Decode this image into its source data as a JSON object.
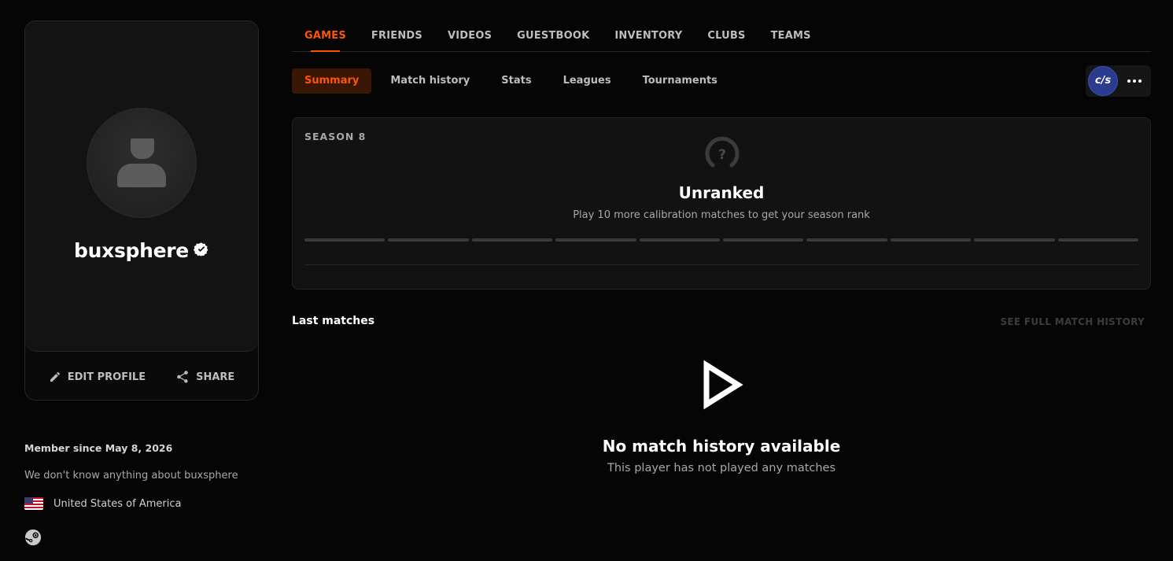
{
  "profile": {
    "username": "buxsphere",
    "edit_label": "EDIT PROFILE",
    "share_label": "SHARE",
    "member_since": "Member since May 8, 2026",
    "bio": "We don't know anything about buxsphere",
    "country": "United States of America"
  },
  "top_nav": {
    "tabs": [
      "GAMES",
      "FRIENDS",
      "VIDEOS",
      "GUESTBOOK",
      "INVENTORY",
      "CLUBS",
      "TEAMS"
    ],
    "active_index": 0
  },
  "sub_nav": {
    "tabs": [
      "Summary",
      "Match history",
      "Stats",
      "Leagues",
      "Tournaments"
    ],
    "active_index": 0
  },
  "game_switch": {
    "badge": "c/s"
  },
  "season": {
    "label": "SEASON 8",
    "rank_icon": "?",
    "rank_title": "Unranked",
    "rank_sub": "Play 10 more calibration matches to get your season rank",
    "calibration_total": 10,
    "calibration_done": 0
  },
  "matches": {
    "title": "Last matches",
    "full_history_link": "SEE FULL MATCH HISTORY",
    "empty_title": "No match history available",
    "empty_sub": "This player has not played any matches"
  },
  "colors": {
    "accent": "#ff5500",
    "background": "#050505",
    "card": "#121212"
  }
}
